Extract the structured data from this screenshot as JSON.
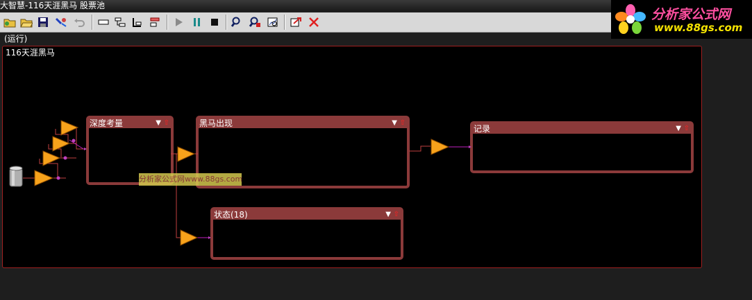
{
  "window": {
    "title": "大智慧-116天涯黑马 股票池"
  },
  "logo": {
    "brand": "分析家公式网",
    "url": "www.88gs.com"
  },
  "toolbar": {
    "buttons": [
      {
        "icon": "new-folder-icon"
      },
      {
        "icon": "open-folder-icon"
      },
      {
        "icon": "save-icon"
      },
      {
        "icon": "connect-icon"
      },
      {
        "icon": "undo-icon"
      },
      {
        "icon": "single-layout-icon"
      },
      {
        "icon": "tree-layout-icon"
      },
      {
        "icon": "branch-layout-icon"
      },
      {
        "icon": "list-layout-icon"
      },
      {
        "icon": "run-icon"
      },
      {
        "icon": "pause-icon"
      },
      {
        "icon": "stop-icon"
      },
      {
        "icon": "search-icon"
      },
      {
        "icon": "find-stock-icon"
      },
      {
        "icon": "chart-search-icon"
      },
      {
        "icon": "export-icon"
      },
      {
        "icon": "close-icon"
      }
    ]
  },
  "status": "(运行)",
  "canvas": {
    "title": "116天涯黑马",
    "nodes": {
      "depth": "深度考量",
      "darkhorse": "黑马出现",
      "record": "记录",
      "state": "状态(18)"
    },
    "watermark": "分析家公式网www.88gs.com"
  },
  "colors": {
    "node_border": "#8b3a3a",
    "canvas_border": "#a02020",
    "filter_fill": "#f7a21b"
  }
}
